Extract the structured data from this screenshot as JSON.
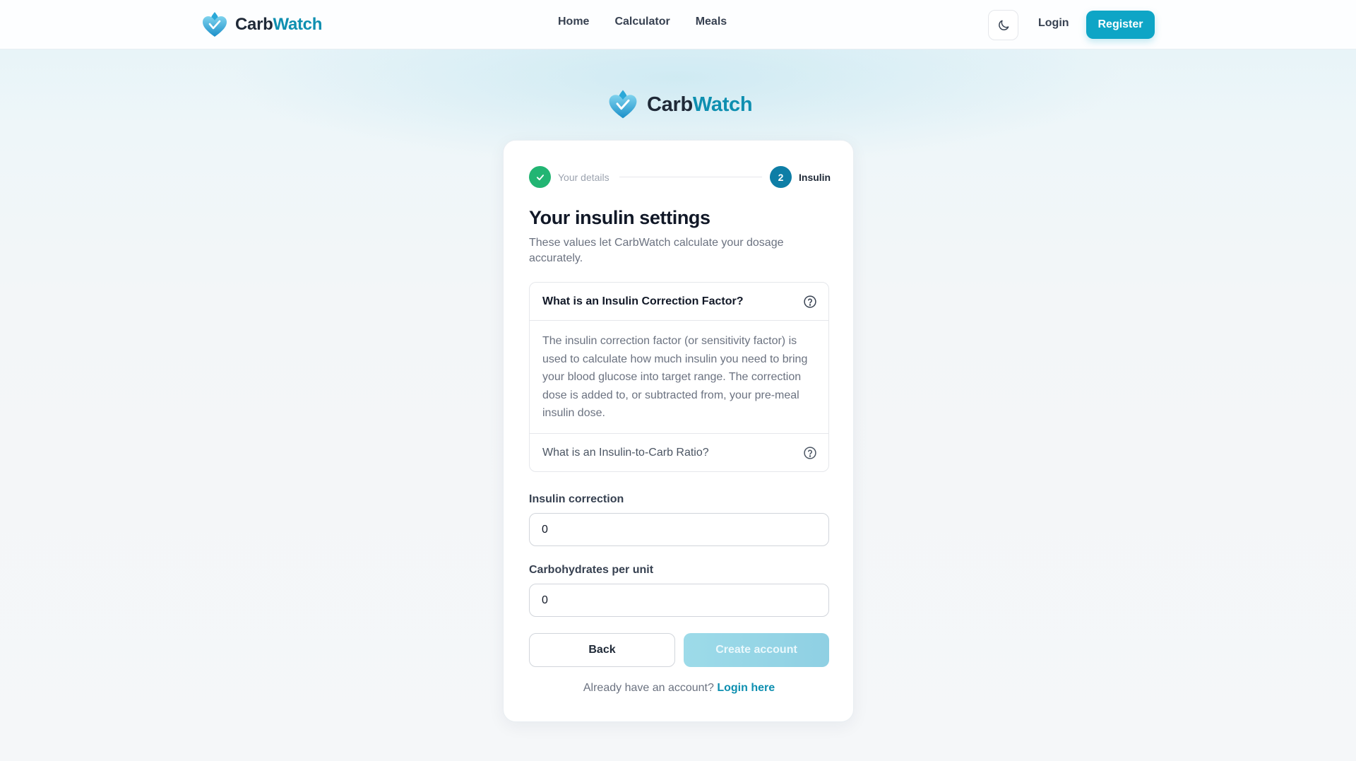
{
  "header": {
    "brand_part1": "Carb",
    "brand_part2": "Watch",
    "nav": [
      "Home",
      "Calculator",
      "Meals"
    ],
    "theme_toggle_icon": "moon-icon",
    "login_label": "Login",
    "register_label": "Register"
  },
  "page": {
    "brand_part1": "Carb",
    "brand_part2": "Watch",
    "logo_icon": "heart-drop-logo-icon"
  },
  "stepper": {
    "step1_label": "Your details",
    "step1_status": "complete",
    "step2_number": "2",
    "step2_label": "Insulin",
    "step2_status": "active"
  },
  "form": {
    "title": "Your insulin settings",
    "subtitle": "These values let CarbWatch calculate your dosage accurately.",
    "accordion": [
      {
        "question": "What is an Insulin Correction Factor?",
        "expanded": true,
        "answer": "The insulin correction factor (or sensitivity factor) is used to calculate how much insulin you need to bring your blood glucose into target range. The correction dose is added to, or subtracted from, your pre-meal insulin dose."
      },
      {
        "question": "What is an Insulin-to-Carb Ratio?",
        "expanded": false
      }
    ],
    "insulin_correction_label": "Insulin correction",
    "insulin_correction_value": "0",
    "carbs_per_unit_label": "Carbohydrates per unit",
    "carbs_per_unit_value": "0",
    "back_label": "Back",
    "create_label": "Create account",
    "footer_prompt": "Already have an account?",
    "footer_link": "Login here"
  },
  "colors": {
    "accent": "#0ea5c6",
    "brand_teal": "#0e8fb0",
    "success": "#22b573",
    "step_active": "#0e7ea6"
  }
}
